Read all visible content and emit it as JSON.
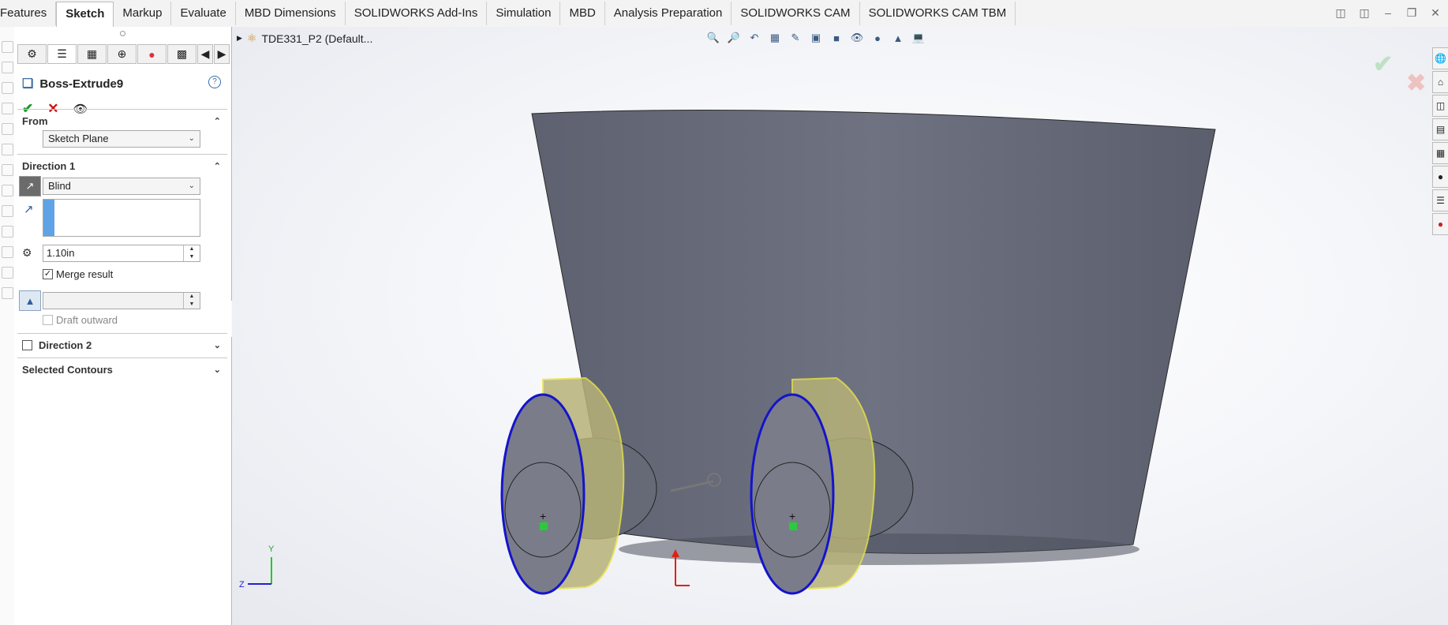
{
  "ribbon": {
    "tabs": [
      {
        "label": "Features"
      },
      {
        "label": "Sketch"
      },
      {
        "label": "Markup"
      },
      {
        "label": "Evaluate"
      },
      {
        "label": "MBD Dimensions"
      },
      {
        "label": "SOLIDWORKS Add-Ins"
      },
      {
        "label": "Simulation"
      },
      {
        "label": "MBD"
      },
      {
        "label": "Analysis Preparation"
      },
      {
        "label": "SOLIDWORKS CAM"
      },
      {
        "label": "SOLIDWORKS CAM TBM"
      }
    ],
    "active_tab": "Sketch"
  },
  "property_manager": {
    "title": "Boss-Extrude9",
    "help_symbol": "?",
    "from": {
      "header": "From",
      "value": "Sketch Plane"
    },
    "direction1": {
      "header": "Direction 1",
      "end_condition": "Blind",
      "depth": "1.10in",
      "merge_result_label": "Merge result",
      "merge_result_checked": true,
      "draft_outward_label": "Draft outward",
      "draft_outward_checked": false
    },
    "direction2": {
      "header": "Direction 2",
      "checked": false
    },
    "selected_contours": {
      "header": "Selected Contours"
    }
  },
  "graphics": {
    "document_title": "TDE331_P2  (Default...",
    "triad": {
      "y": "Y",
      "z": "Z"
    }
  },
  "colors": {
    "ok_green": "#1c9a2a",
    "cancel_red": "#cc1111",
    "sketch_blue": "#1111cc",
    "preview_yellow": "#e8e24a",
    "body_gray": "#6a6e7c"
  }
}
